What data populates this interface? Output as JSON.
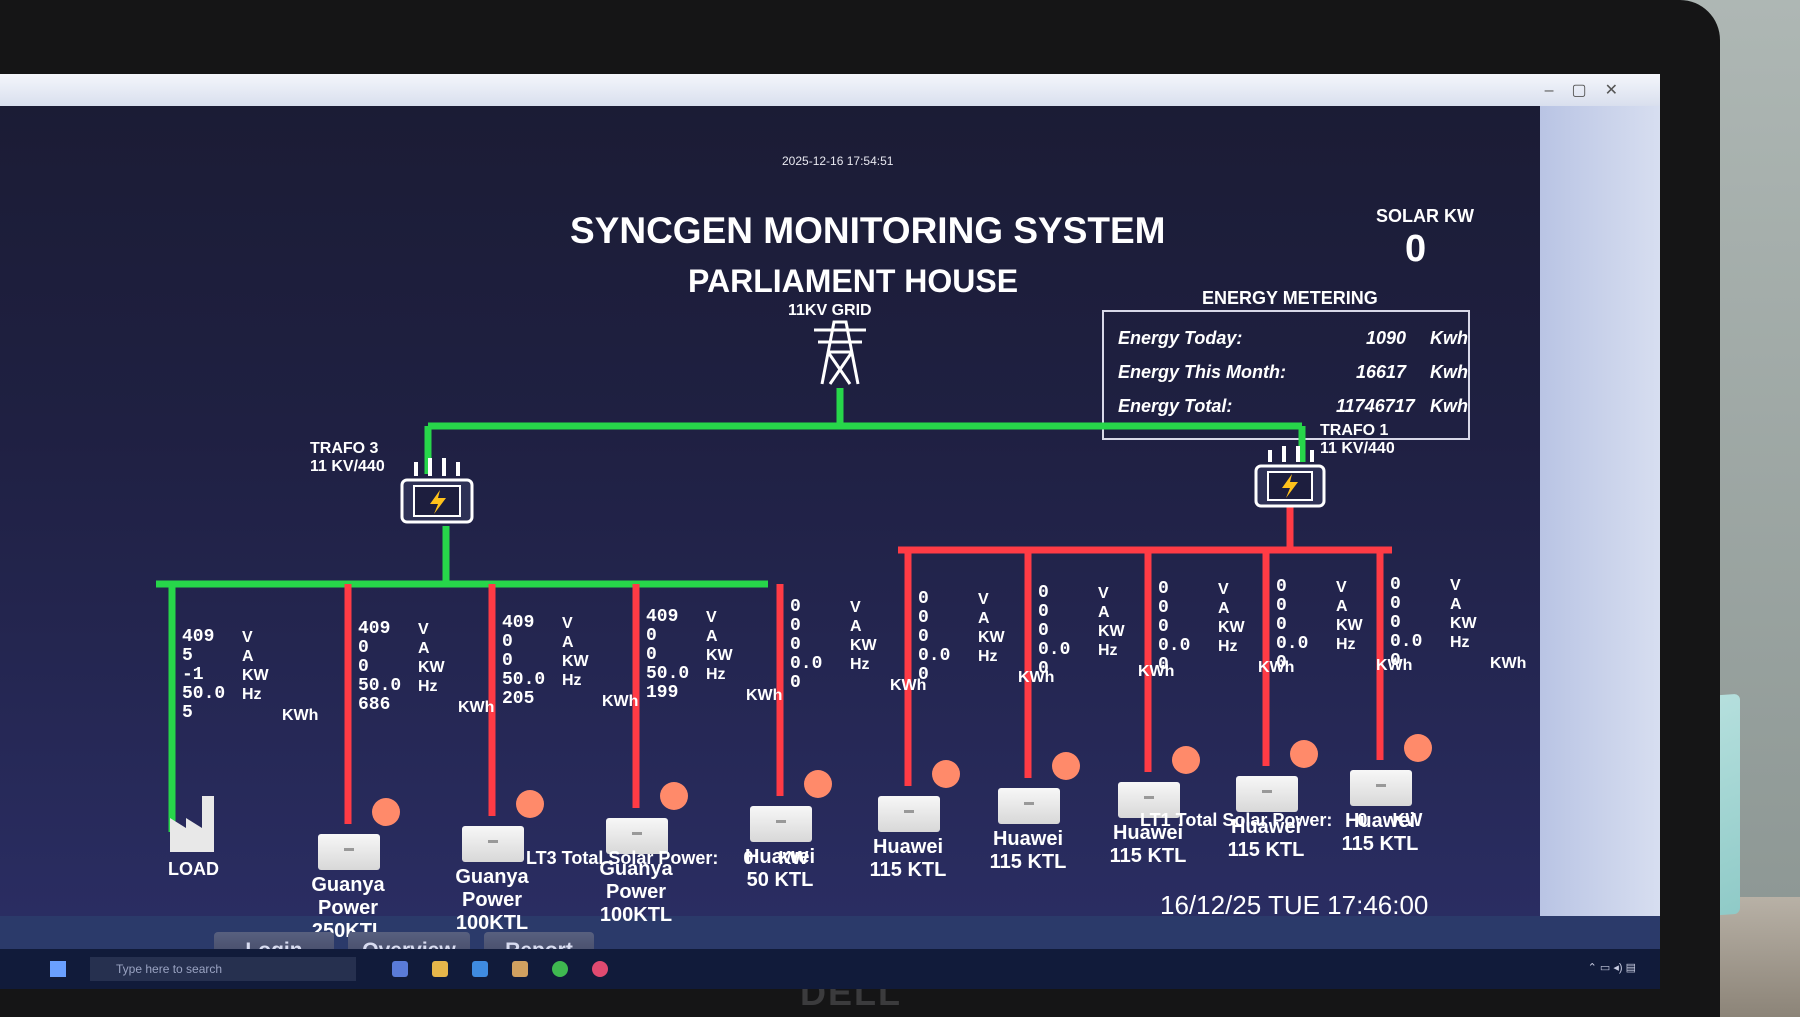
{
  "window": {
    "timestamp": "2025-12-16 17:54:51"
  },
  "header": {
    "title": "SYNCGEN MONITORING SYSTEM",
    "subtitle": "PARLIAMENT HOUSE"
  },
  "solar": {
    "label": "SOLAR KW",
    "value": "0"
  },
  "energy_metering": {
    "label": "ENERGY METERING",
    "rows": [
      {
        "label": "Energy Today:",
        "value": "1090",
        "unit": "Kwh"
      },
      {
        "label": "Energy This Month:",
        "value": "16617",
        "unit": "Kwh"
      },
      {
        "label": "Energy Total:",
        "value": "11746717",
        "unit": "Kwh"
      }
    ]
  },
  "grid": {
    "label": "11KV GRID"
  },
  "trafo3": {
    "name": "TRAFO 3",
    "rating": "11 KV/440"
  },
  "trafo1": {
    "name": "TRAFO 1",
    "rating": "11 KV/440"
  },
  "meter_units": {
    "v": "V",
    "a": "A",
    "kw": "KW",
    "hz": "Hz",
    "kwh": "KWh"
  },
  "feeders": [
    {
      "vals": [
        "409",
        "5",
        "-1",
        "50.0",
        "5"
      ],
      "label": "LOAD",
      "status": "green"
    },
    {
      "vals": [
        "409",
        "0",
        "0",
        "50.0",
        "686"
      ],
      "label": "Guanya\nPower\n250KTL",
      "status": "red"
    },
    {
      "vals": [
        "409",
        "0",
        "0",
        "50.0",
        "205"
      ],
      "label": "Guanya\nPower\n100KTL",
      "status": "red"
    },
    {
      "vals": [
        "409",
        "0",
        "0",
        "50.0",
        "199"
      ],
      "label": "Guanya\nPower\n100KTL",
      "status": "red"
    },
    {
      "vals": [
        "0",
        "0",
        "0",
        "0.0",
        "0"
      ],
      "label": "Huawei\n50  KTL",
      "status": "red"
    },
    {
      "vals": [
        "0",
        "0",
        "0",
        "0.0",
        "0"
      ],
      "label": "Huawei\n115 KTL",
      "status": "red"
    },
    {
      "vals": [
        "0",
        "0",
        "0",
        "0.0",
        "0"
      ],
      "label": "Huawei\n115 KTL",
      "status": "red"
    },
    {
      "vals": [
        "0",
        "0",
        "0",
        "0.0",
        "0"
      ],
      "label": "Huawei\n115 KTL",
      "status": "red"
    },
    {
      "vals": [
        "0",
        "0",
        "0",
        "0.0",
        "0"
      ],
      "label": "Huawei\n115 KTL",
      "status": "red"
    },
    {
      "vals": [
        "0",
        "0",
        "0",
        "0.0",
        "0"
      ],
      "label": "Huawei\n115 KTL",
      "status": "red"
    }
  ],
  "totals": {
    "lt3_label": "LT3 Total Solar Power:",
    "lt3_value": "0",
    "lt3_unit": "KW",
    "lt1_label": "LT1 Total Solar Power:",
    "lt1_value": "0",
    "lt1_unit": "KW"
  },
  "datetime": "16/12/25 TUE 17:46:00",
  "nav": {
    "login": "Login",
    "overview": "Overview",
    "report": "Report"
  },
  "taskbar": {
    "search_placeholder": "Type here to search"
  },
  "bezel": {
    "brand": "DELL"
  },
  "colors": {
    "green": "#27d64a",
    "red": "#ff3b45",
    "bg": "#1d1e3e"
  }
}
